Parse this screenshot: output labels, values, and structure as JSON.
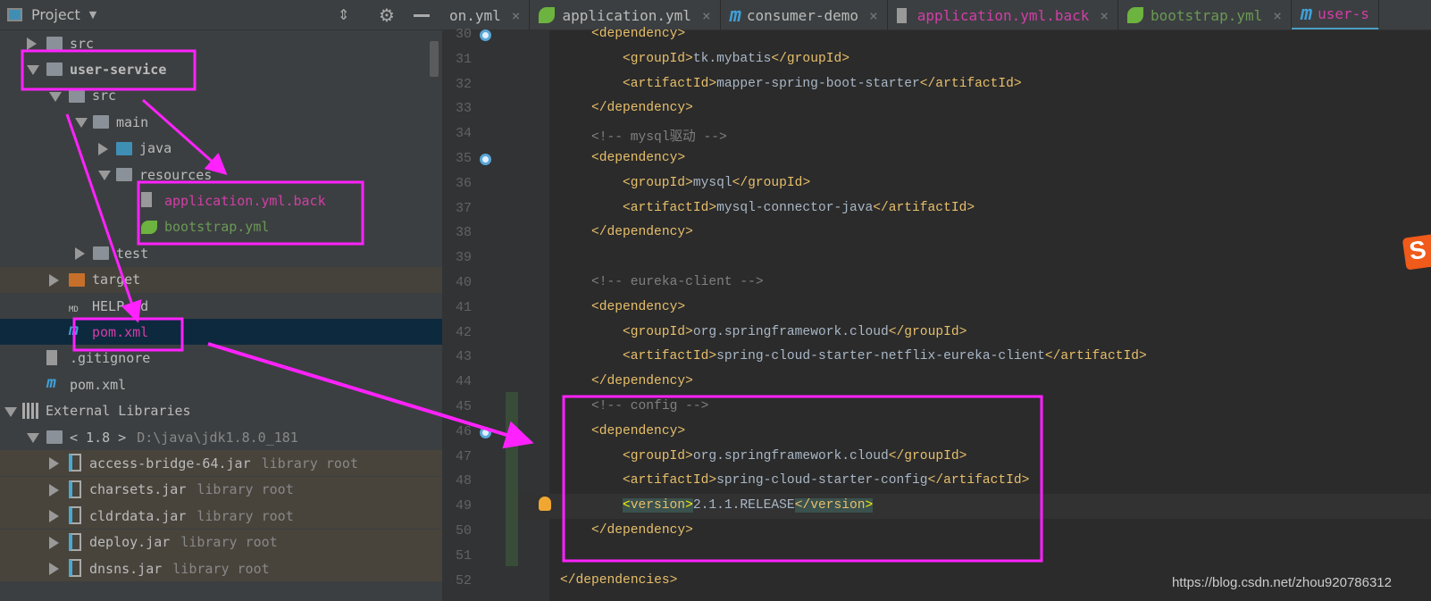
{
  "project_panel": {
    "title": "Project",
    "tree": [
      {
        "label": "src",
        "depth": 1,
        "arrow": "r",
        "type": "folder"
      },
      {
        "label": "user-service",
        "depth": 1,
        "arrow": "d",
        "type": "module",
        "bold": true
      },
      {
        "label": "src",
        "depth": 2,
        "arrow": "d",
        "type": "folder"
      },
      {
        "label": "main",
        "depth": 3,
        "arrow": "d",
        "type": "folder"
      },
      {
        "label": "java",
        "depth": 4,
        "arrow": "r",
        "type": "folder-blue"
      },
      {
        "label": "resources",
        "depth": 4,
        "arrow": "d",
        "type": "folder"
      },
      {
        "label": "application.yml.back",
        "depth": 5,
        "type": "file",
        "color": "#d13fa7"
      },
      {
        "label": "bootstrap.yml",
        "depth": 5,
        "type": "spring",
        "color": "#6a9955"
      },
      {
        "label": "test",
        "depth": 3,
        "arrow": "r",
        "type": "folder"
      },
      {
        "label": "target",
        "depth": 2,
        "arrow": "r",
        "type": "folder-orange",
        "excluded": true
      },
      {
        "label": "HELP.md",
        "depth": 2,
        "type": "md"
      },
      {
        "label": "pom.xml",
        "depth": 2,
        "type": "maven",
        "color": "#d13fa7",
        "selected": true
      },
      {
        "label": ".gitignore",
        "depth": 1,
        "type": "file"
      },
      {
        "label": "pom.xml",
        "depth": 1,
        "type": "maven"
      },
      {
        "label": "External Libraries",
        "depth": 0,
        "arrow": "d",
        "type": "libs"
      },
      {
        "label": "< 1.8 >",
        "sub": "D:\\java\\jdk1.8.0_181",
        "depth": 1,
        "arrow": "d",
        "type": "jdk"
      },
      {
        "label": "access-bridge-64.jar",
        "sub": "library root",
        "depth": 2,
        "arrow": "r",
        "type": "jar",
        "lib": true
      },
      {
        "label": "charsets.jar",
        "sub": "library root",
        "depth": 2,
        "arrow": "r",
        "type": "jar",
        "lib": true
      },
      {
        "label": "cldrdata.jar",
        "sub": "library root",
        "depth": 2,
        "arrow": "r",
        "type": "jar",
        "lib": true
      },
      {
        "label": "deploy.jar",
        "sub": "library root",
        "depth": 2,
        "arrow": "r",
        "type": "jar",
        "lib": true
      },
      {
        "label": "dnsns.jar",
        "sub": "library root",
        "depth": 2,
        "arrow": "r",
        "type": "jar",
        "lib": true
      }
    ]
  },
  "tabs": [
    {
      "label": "on.yml",
      "icon": "none",
      "color": "#bbbbbb"
    },
    {
      "label": "application.yml",
      "icon": "spring-icon",
      "color": "#bbbbbb"
    },
    {
      "label": "consumer-demo",
      "icon": "maven-icon",
      "color": "#bbbbbb"
    },
    {
      "label": "application.yml.back",
      "icon": "file-icon",
      "color": "#d13fa7"
    },
    {
      "label": "bootstrap.yml",
      "icon": "spring-icon",
      "color": "#6a9955"
    },
    {
      "label": "user-s",
      "icon": "maven-icon",
      "color": "#d13fa7",
      "active": true
    }
  ],
  "editor": {
    "lines": [
      {
        "n": "30",
        "d": 1,
        "parts": [
          [
            "t",
            "<dependency>"
          ]
        ]
      },
      {
        "n": "31",
        "d": 2,
        "parts": [
          [
            "t",
            "<groupId>"
          ],
          [
            "",
            "tk.mybatis"
          ],
          [
            "t",
            "</groupId>"
          ]
        ]
      },
      {
        "n": "32",
        "d": 2,
        "parts": [
          [
            "t",
            "<artifactId>"
          ],
          [
            "",
            "mapper-spring-boot-starter"
          ],
          [
            "t",
            "</artifactId>"
          ]
        ]
      },
      {
        "n": "33",
        "d": 1,
        "parts": [
          [
            "t",
            "</dependency>"
          ]
        ]
      },
      {
        "n": "34",
        "d": 1,
        "parts": [
          [
            "c",
            "<!-- mysql驱动 -->"
          ]
        ]
      },
      {
        "n": "35",
        "d": 1,
        "parts": [
          [
            "t",
            "<dependency>"
          ]
        ]
      },
      {
        "n": "36",
        "d": 2,
        "parts": [
          [
            "t",
            "<groupId>"
          ],
          [
            "",
            "mysql"
          ],
          [
            "t",
            "</groupId>"
          ]
        ]
      },
      {
        "n": "37",
        "d": 2,
        "parts": [
          [
            "t",
            "<artifactId>"
          ],
          [
            "",
            "mysql-connector-java"
          ],
          [
            "t",
            "</artifactId>"
          ]
        ]
      },
      {
        "n": "38",
        "d": 1,
        "parts": [
          [
            "t",
            "</dependency>"
          ]
        ]
      },
      {
        "n": "39",
        "d": 1,
        "parts": []
      },
      {
        "n": "40",
        "d": 1,
        "parts": [
          [
            "c",
            "<!-- eureka-client -->"
          ]
        ]
      },
      {
        "n": "41",
        "d": 1,
        "parts": [
          [
            "t",
            "<dependency>"
          ]
        ]
      },
      {
        "n": "42",
        "d": 2,
        "parts": [
          [
            "t",
            "<groupId>"
          ],
          [
            "",
            "org.springframework.cloud"
          ],
          [
            "t",
            "</groupId>"
          ]
        ]
      },
      {
        "n": "43",
        "d": 2,
        "parts": [
          [
            "t",
            "<artifactId>"
          ],
          [
            "",
            "spring-cloud-starter-netflix-eureka-client"
          ],
          [
            "t",
            "</artifactId>"
          ]
        ]
      },
      {
        "n": "44",
        "d": 1,
        "parts": [
          [
            "t",
            "</dependency>"
          ]
        ]
      },
      {
        "n": "45",
        "d": 1,
        "parts": [
          [
            "c",
            "<!-- config -->"
          ]
        ]
      },
      {
        "n": "46",
        "d": 1,
        "parts": [
          [
            "t",
            "<dependency>"
          ]
        ]
      },
      {
        "n": "47",
        "d": 2,
        "parts": [
          [
            "t",
            "<groupId>"
          ],
          [
            "",
            "org.springframework.cloud"
          ],
          [
            "t",
            "</groupId>"
          ]
        ]
      },
      {
        "n": "48",
        "d": 2,
        "parts": [
          [
            "t",
            "<artifactId>"
          ],
          [
            "",
            "spring-cloud-starter-config"
          ],
          [
            "t",
            "</artifactId>"
          ]
        ]
      },
      {
        "n": "49",
        "d": 2,
        "parts": [
          [
            "t hl yl",
            "<"
          ],
          [
            "t hl",
            "version"
          ],
          [
            "t hl yl",
            ">"
          ],
          [
            "",
            "2.1.1.RELEASE"
          ],
          [
            "t hl",
            "</version"
          ],
          [
            "t hl yl",
            ">"
          ]
        ]
      },
      {
        "n": "50",
        "d": 1,
        "parts": [
          [
            "t",
            "</dependency>"
          ]
        ]
      },
      {
        "n": "51",
        "d": 1,
        "parts": []
      },
      {
        "n": "52",
        "d": 0,
        "parts": [
          [
            "t",
            "</dependencies>"
          ]
        ]
      }
    ]
  },
  "watermark": "https://blog.csdn.net/zhou920786312",
  "colors": {
    "annotation": "#ff22ff",
    "tag": "#e8bf6a",
    "text": "#a9b7c6",
    "comment": "#808080",
    "selection": "#0d293e"
  }
}
